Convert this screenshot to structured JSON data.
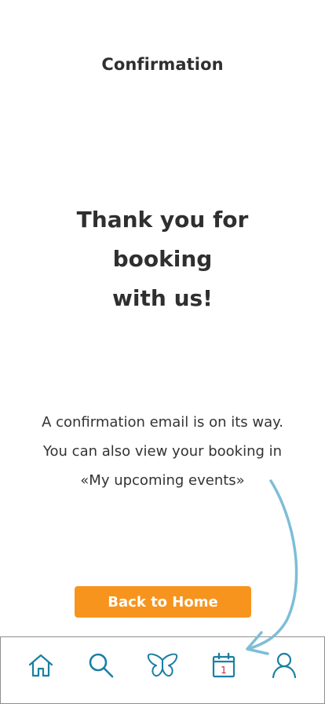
{
  "header": {
    "title": "Confirmation"
  },
  "main": {
    "thank_you_lines": [
      "Thank you for",
      "booking",
      "with us!"
    ],
    "info_lines": [
      "A confirmation email is on its way.",
      "You can also view your booking in",
      "«My upcoming events»"
    ],
    "back_button_label": "Back to Home"
  },
  "tabbar": {
    "items": [
      {
        "icon": "home-icon"
      },
      {
        "icon": "search-icon"
      },
      {
        "icon": "butterfly-icon"
      },
      {
        "icon": "calendar-icon",
        "badge": "1"
      },
      {
        "icon": "user-icon"
      }
    ]
  },
  "colors": {
    "accent_orange": "#f7941d",
    "icon_blue": "#1a7fa3",
    "arrow_blue": "#7fbdd6",
    "calendar_badge_red": "#d0203b",
    "text_dark": "#2f2f2f"
  }
}
